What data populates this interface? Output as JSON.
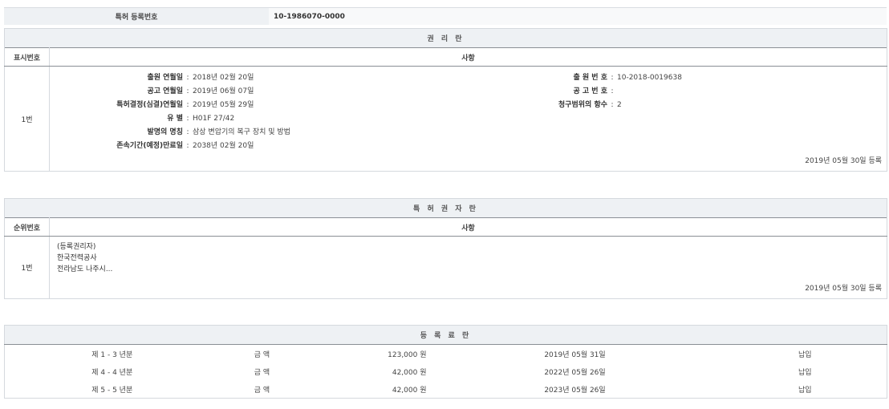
{
  "registration": {
    "label": "특허 등록번호",
    "value": "10-1986070-0000"
  },
  "rights": {
    "title": "권 리 란",
    "col_num": "표시번호",
    "col_detail": "사항",
    "row_num": "1번",
    "left_fields": [
      {
        "label": "출원 연월일",
        "value": "2018년 02월 20일"
      },
      {
        "label": "공고 연월일",
        "value": "2019년 06월 07일"
      },
      {
        "label": "특허결정(심결)연월일",
        "value": "2019년 05월 29일"
      },
      {
        "label": "유  별",
        "value": "H01F 27/42"
      },
      {
        "label": "발명의 명칭",
        "value": "삼상 변압기의 복구 장치 및 방법"
      },
      {
        "label": "존속기간(예정)만료일",
        "value": "2038년 02월 20일"
      }
    ],
    "right_fields": [
      {
        "label": "출 원 번 호",
        "value": "10-2018-0019638"
      },
      {
        "label": "공 고 번 호",
        "value": ""
      },
      {
        "label": "청구범위의 항수",
        "value": "2"
      }
    ],
    "reg_date": "2019년 05월 30일 등록"
  },
  "holders": {
    "title": "특 허 권 자 란",
    "col_num": "순위번호",
    "col_detail": "사항",
    "row_num": "1번",
    "lines": [
      "(등록권리자)",
      "한국전력공사",
      "전라남도 나주시..."
    ],
    "reg_date": "2019년 05월 30일 등록"
  },
  "fees": {
    "title": "등 록 료 란",
    "rows": [
      {
        "period": "제 1 - 3 년분",
        "label": "금 액",
        "amount": "123,000 원",
        "date": "2019년 05월 31일",
        "status": "납입"
      },
      {
        "period": "제 4 - 4 년분",
        "label": "금 액",
        "amount": "42,000 원",
        "date": "2022년 05월 26일",
        "status": "납입"
      },
      {
        "period": "제 5 - 5 년분",
        "label": "금 액",
        "amount": "42,000 원",
        "date": "2023년 05월 26일",
        "status": "납입"
      }
    ]
  }
}
